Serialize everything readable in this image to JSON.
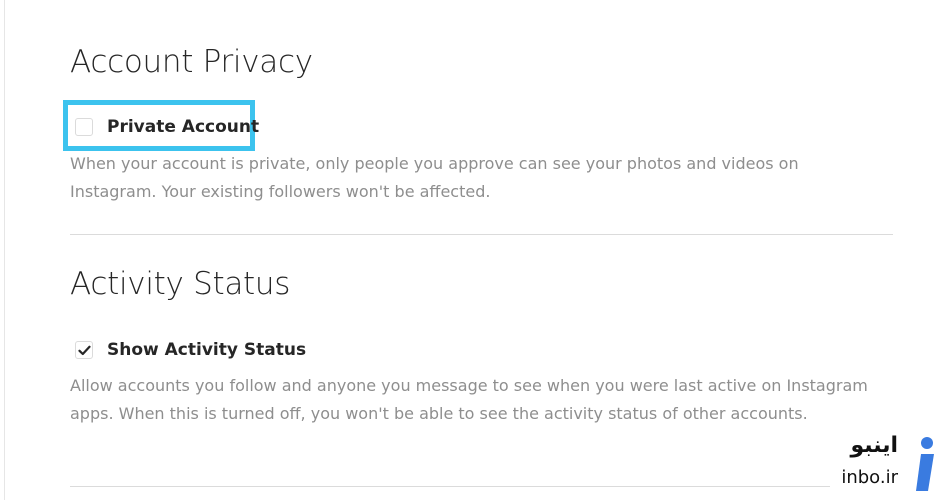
{
  "privacy": {
    "title": "Account Privacy",
    "option_label": "Private Account",
    "checked": false,
    "help": "When your account is private, only people you approve can see your photos and videos on Instagram. Your existing followers won't be affected."
  },
  "activity": {
    "title": "Activity Status",
    "option_label": "Show Activity Status",
    "checked": true,
    "help": "Allow accounts you follow and anyone you message to see when you were last active on Instagram apps. When this is turned off, you won't be able to see the activity status of other accounts."
  },
  "watermark": {
    "arabic": "اینبو",
    "latin": "inbo.ir"
  },
  "colors": {
    "highlight": "#3cc3ee",
    "muted_text": "#8e8e8e",
    "divider": "#dbdbdb",
    "logo_blue": "#3a7be0"
  }
}
